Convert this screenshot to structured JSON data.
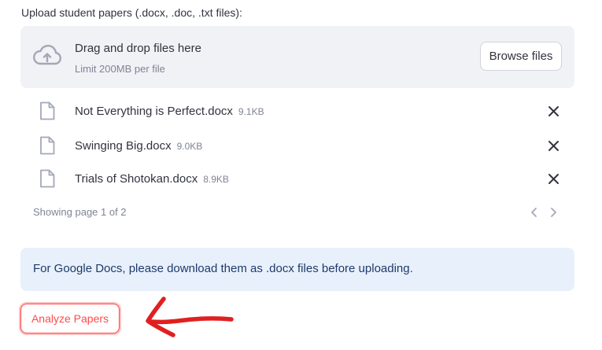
{
  "uploader": {
    "label": "Upload student papers (.docx, .doc, .txt files):",
    "dropzone_title": "Drag and drop files here",
    "dropzone_subtitle": "Limit 200MB per file",
    "browse_label": "Browse files",
    "upload_icon": "cloud-upload-icon"
  },
  "files": [
    {
      "name": "Not Everything is Perfect.docx",
      "size": "9.1KB",
      "icon": "file-icon",
      "remove_icon": "close-icon"
    },
    {
      "name": "Swinging Big.docx",
      "size": "9.0KB",
      "icon": "file-icon",
      "remove_icon": "close-icon"
    },
    {
      "name": "Trials of Shotokan.docx",
      "size": "8.9KB",
      "icon": "file-icon",
      "remove_icon": "close-icon"
    }
  ],
  "pagination": {
    "text": "Showing page 1 of 2",
    "prev_icon": "chevron-left-icon",
    "next_icon": "chevron-right-icon"
  },
  "alert": {
    "text": "For Google Docs, please download them as .docx files before uploading."
  },
  "actions": {
    "analyze_label": "Analyze Papers"
  },
  "annotation": {
    "arrow_icon": "red-arrow-icon",
    "arrow_color": "#e02020"
  },
  "colors": {
    "accent": "#ff4b4b",
    "dropzone_bg": "#f0f2f6",
    "alert_bg": "#e8f0fb",
    "alert_text": "#1e3a6b"
  }
}
